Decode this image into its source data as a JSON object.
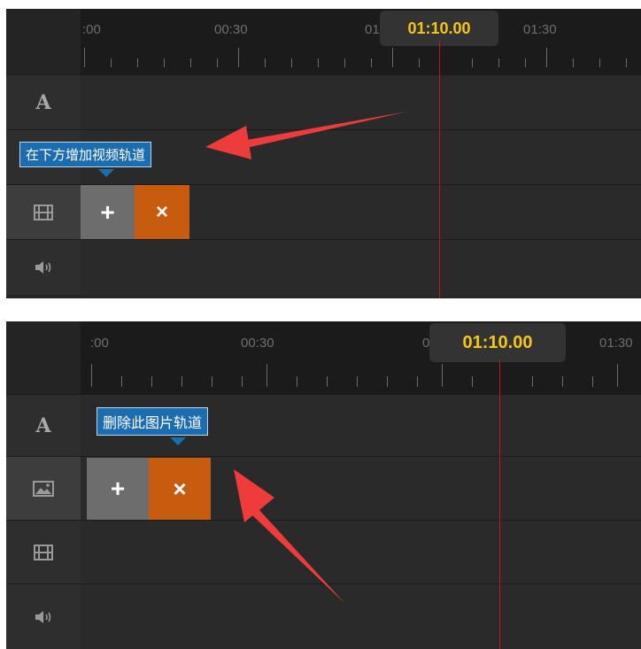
{
  "panel_top": {
    "ruler": {
      "tick_labels": [
        ":00",
        "00:30",
        "01:",
        "01:30"
      ],
      "current_time": "01:10.00"
    },
    "tracks": [
      {
        "icon": "text-track-icon",
        "label": "A"
      },
      {
        "icon": "empty-track"
      },
      {
        "icon": "film-icon"
      },
      {
        "icon": "speaker-icon"
      }
    ],
    "tooltip": "在下方增加视频轨道",
    "add_label": "+",
    "delete_label": "×"
  },
  "panel_bottom": {
    "ruler": {
      "tick_labels": [
        ":00",
        "00:30",
        "01:",
        "01:30"
      ],
      "current_time": "01:10.00"
    },
    "tracks": [
      {
        "icon": "text-track-icon",
        "label": "A"
      },
      {
        "icon": "image-icon"
      },
      {
        "icon": "film-icon"
      },
      {
        "icon": "speaker-icon"
      }
    ],
    "tooltip": "删除此图片轨道",
    "add_label": "+",
    "delete_label": "×"
  },
  "colors": {
    "accent_time": "#f5c518",
    "playhead": "#c01818",
    "delete_button": "#c85c0e",
    "tooltip_bg": "#1c6cb0",
    "annotation_arrow": "#ee3b3b"
  }
}
